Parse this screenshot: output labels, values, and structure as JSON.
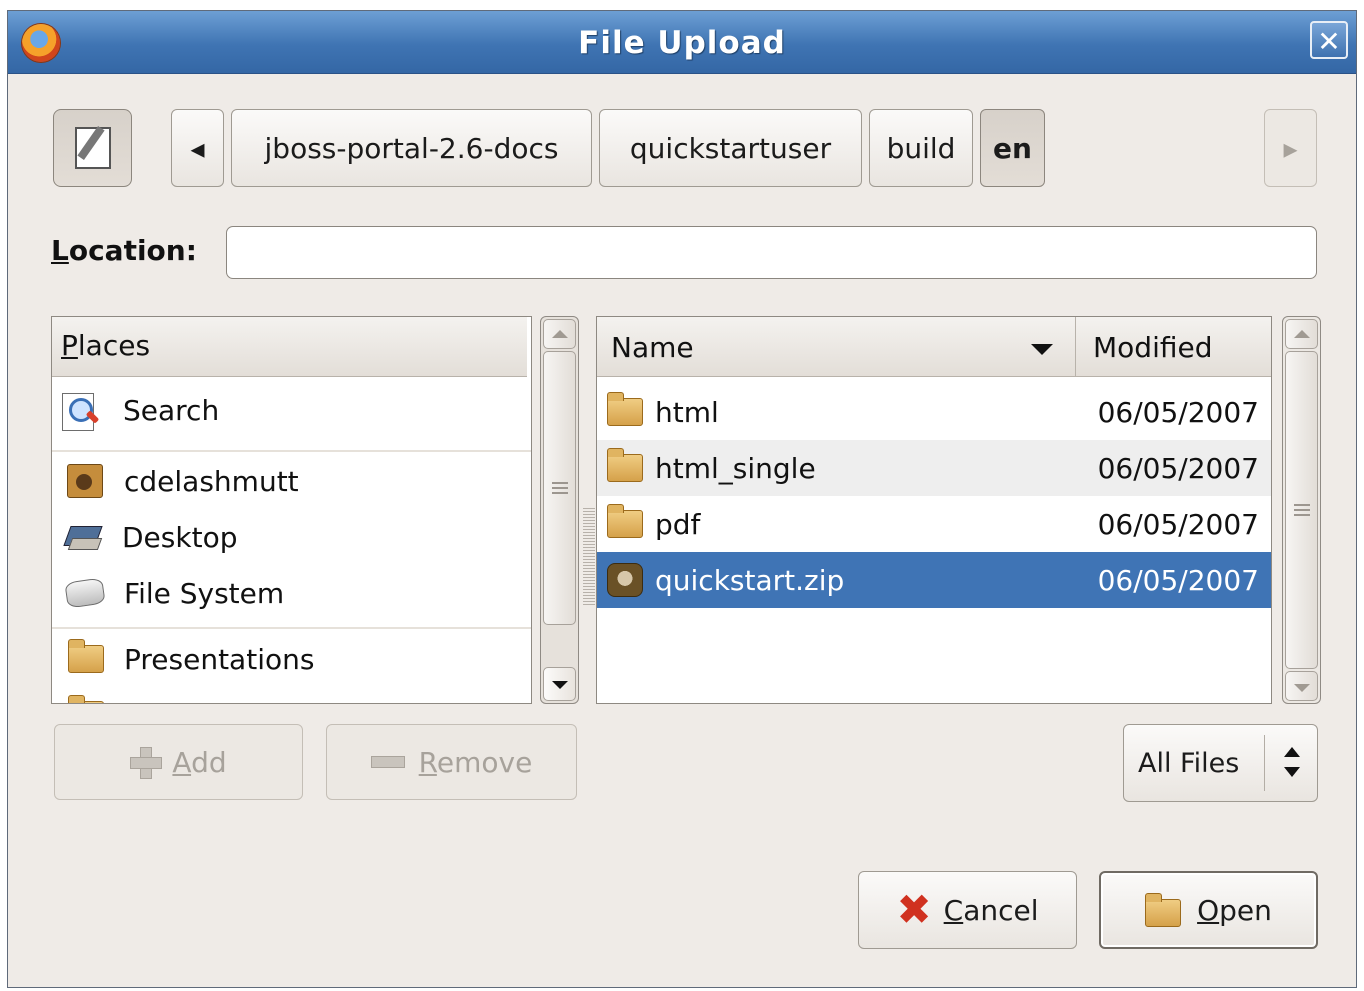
{
  "window": {
    "title": "File Upload",
    "close_label": "✕"
  },
  "pathbar": {
    "segments": [
      "jboss-portal-2.6-docs",
      "quickstartuser",
      "build",
      "en"
    ],
    "left_arrow": "◂",
    "right_arrow": "▸"
  },
  "location": {
    "label_underline": "L",
    "label_rest": "ocation:",
    "value": ""
  },
  "places": {
    "header_underline": "P",
    "header_rest": "laces",
    "items": [
      {
        "label": "Search",
        "icon": "search-icon"
      },
      {
        "label": "cdelashmutt",
        "icon": "home-folder-icon"
      },
      {
        "label": "Desktop",
        "icon": "desktop-icon"
      },
      {
        "label": "File System",
        "icon": "harddrive-icon"
      },
      {
        "label": "Presentations",
        "icon": "folder-icon"
      }
    ]
  },
  "files": {
    "col_name": "Name",
    "col_modified": "Modified",
    "rows": [
      {
        "name": "html",
        "modified": "06/05/2007",
        "icon": "folder-icon"
      },
      {
        "name": "html_single",
        "modified": "06/05/2007",
        "icon": "folder-icon"
      },
      {
        "name": "pdf",
        "modified": "06/05/2007",
        "icon": "folder-icon"
      },
      {
        "name": "quickstart.zip",
        "modified": "06/05/2007",
        "icon": "archive-icon",
        "selected": true
      }
    ]
  },
  "buttons": {
    "add_underline": "A",
    "add_rest": "dd",
    "remove_underline": "R",
    "remove_rest": "emove",
    "filter": "All Files",
    "cancel_underline": "C",
    "cancel_rest": "ancel",
    "open_underline": "O",
    "open_rest": "pen"
  },
  "colors": {
    "titlebar": "#3f74b3",
    "selection": "#3f74b5",
    "background": "#efebe7"
  }
}
